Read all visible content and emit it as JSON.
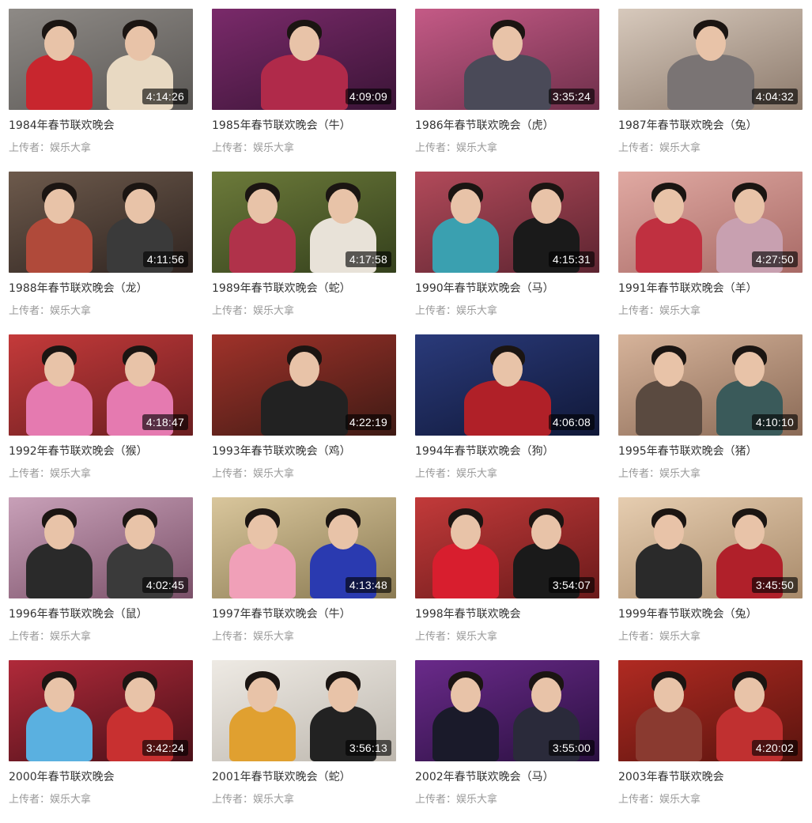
{
  "uploader_prefix": "上传者：",
  "videos": [
    {
      "title": "1984年春节联欢晚会",
      "duration": "4:14:26",
      "uploader": "娱乐大拿",
      "bg": [
        "#8e8a86",
        "#5a5754"
      ],
      "figs": [
        "#c8262e",
        "#e8d9c2"
      ]
    },
    {
      "title": "1985年春节联欢晚会（牛）",
      "duration": "4:09:09",
      "uploader": "娱乐大拿",
      "bg": [
        "#7a2a6a",
        "#3a1436"
      ],
      "figs": [
        "#b02a4a"
      ]
    },
    {
      "title": "1986年春节联欢晚会（虎）",
      "duration": "3:35:24",
      "uploader": "娱乐大拿",
      "bg": [
        "#c45a86",
        "#6e2f4a"
      ],
      "figs": [
        "#4a4a58"
      ]
    },
    {
      "title": "1987年春节联欢晚会（兔）",
      "duration": "4:04:32",
      "uploader": "娱乐大拿",
      "bg": [
        "#d7c9bc",
        "#8c7a6c"
      ],
      "figs": [
        "#7a7474"
      ]
    },
    {
      "title": "1988年春节联欢晚会（龙）",
      "duration": "4:11:56",
      "uploader": "娱乐大拿",
      "bg": [
        "#6d5a4c",
        "#2f2420"
      ],
      "figs": [
        "#b04a3a",
        "#3a3a3a"
      ]
    },
    {
      "title": "1989年春节联欢晚会（蛇）",
      "duration": "4:17:58",
      "uploader": "娱乐大拿",
      "bg": [
        "#6c7a3a",
        "#34401c"
      ],
      "figs": [
        "#b0324a",
        "#e8e2d8"
      ]
    },
    {
      "title": "1990年春节联欢晚会（马）",
      "duration": "4:15:31",
      "uploader": "娱乐大拿",
      "bg": [
        "#b24a5a",
        "#5c2430"
      ],
      "figs": [
        "#3aa0b0",
        "#1a1a1a"
      ]
    },
    {
      "title": "1991年春节联欢晚会（羊）",
      "duration": "4:27:50",
      "uploader": "娱乐大拿",
      "bg": [
        "#e0a9a2",
        "#a86a66"
      ],
      "figs": [
        "#c03040",
        "#c8a0b0"
      ]
    },
    {
      "title": "1992年春节联欢晚会（猴）",
      "duration": "4:18:47",
      "uploader": "娱乐大拿",
      "bg": [
        "#c43a3a",
        "#6a1e20"
      ],
      "figs": [
        "#e57ab0",
        "#e57ab0"
      ]
    },
    {
      "title": "1993年春节联欢晚会（鸡）",
      "duration": "4:22:19",
      "uploader": "娱乐大拿",
      "bg": [
        "#a0322a",
        "#3e1a14"
      ],
      "figs": [
        "#222222"
      ]
    },
    {
      "title": "1994年春节联欢晚会（狗）",
      "duration": "4:06:08",
      "uploader": "娱乐大拿",
      "bg": [
        "#2a3a7a",
        "#101838"
      ],
      "figs": [
        "#b02028"
      ]
    },
    {
      "title": "1995年春节联欢晚会（猪）",
      "duration": "4:10:10",
      "uploader": "娱乐大拿",
      "bg": [
        "#d6b39a",
        "#8a6a56"
      ],
      "figs": [
        "#5a4a40",
        "#3a5a5a"
      ]
    },
    {
      "title": "1996年春节联欢晚会（鼠）",
      "duration": "4:02:45",
      "uploader": "娱乐大拿",
      "bg": [
        "#c8a0b8",
        "#7a5068"
      ],
      "figs": [
        "#2a2a2a",
        "#3a3a3a"
      ]
    },
    {
      "title": "1997年春节联欢晚会（牛）",
      "duration": "4:13:48",
      "uploader": "娱乐大拿",
      "bg": [
        "#d9c69c",
        "#8a7a52"
      ],
      "figs": [
        "#f0a0b8",
        "#2a3ab0"
      ]
    },
    {
      "title": "1998年春节联欢晚会",
      "duration": "3:54:07",
      "uploader": "娱乐大拿",
      "bg": [
        "#c23a3a",
        "#6a1a1a"
      ],
      "figs": [
        "#d81e2e",
        "#1a1a1a"
      ]
    },
    {
      "title": "1999年春节联欢晚会（兔）",
      "duration": "3:45:50",
      "uploader": "娱乐大拿",
      "bg": [
        "#e6cdb0",
        "#a88a6a"
      ],
      "figs": [
        "#2a2a2a",
        "#b0202a"
      ]
    },
    {
      "title": "2000年春节联欢晚会",
      "duration": "3:42:24",
      "uploader": "娱乐大拿",
      "bg": [
        "#b02a3a",
        "#4a1018"
      ],
      "figs": [
        "#5ab0e0",
        "#c83030"
      ]
    },
    {
      "title": "2001年春节联欢晚会（蛇）",
      "duration": "3:56:13",
      "uploader": "娱乐大拿",
      "bg": [
        "#eeeae4",
        "#bdb7ae"
      ],
      "figs": [
        "#e0a030",
        "#222222"
      ]
    },
    {
      "title": "2002年春节联欢晚会（马）",
      "duration": "3:55:00",
      "uploader": "娱乐大拿",
      "bg": [
        "#6a2a8a",
        "#2a1040"
      ],
      "figs": [
        "#1a1a2a",
        "#2a2a3a"
      ]
    },
    {
      "title": "2003年春节联欢晚会",
      "duration": "4:20:02",
      "uploader": "娱乐大拿",
      "bg": [
        "#b02a22",
        "#5a140e"
      ],
      "figs": [
        "#8a3a30",
        "#c03030"
      ]
    }
  ]
}
